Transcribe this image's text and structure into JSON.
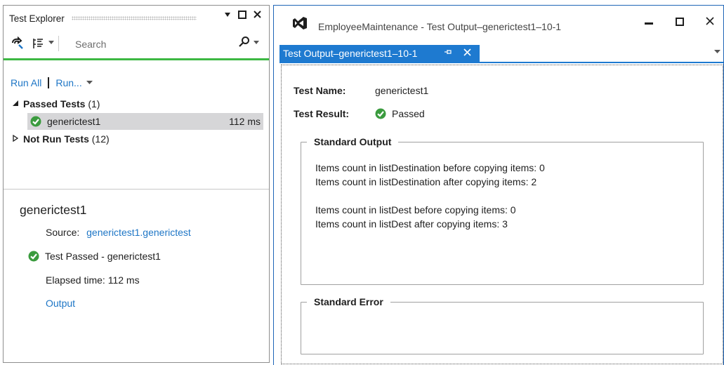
{
  "test_explorer": {
    "title": "Test Explorer",
    "search": {
      "placeholder": "Search",
      "value": ""
    },
    "run_all": "Run All",
    "run_menu": "Run...",
    "groups": {
      "passed": {
        "label": "Passed Tests",
        "count": "(1)"
      },
      "not_run": {
        "label": "Not Run Tests",
        "count": "(12)"
      }
    },
    "tests": [
      {
        "name": "generictest1",
        "duration": "112 ms",
        "status": "passed"
      }
    ],
    "detail": {
      "title": "generictest1",
      "source_label": "Source:",
      "source_link": "generictest1.generictest",
      "result_text": "Test Passed - generictest1",
      "elapsed": "Elapsed time: 112 ms",
      "output_link": "Output"
    }
  },
  "window": {
    "title": "EmployeeMaintenance - Test Output–generictest1–10-1",
    "tab_label": "Test Output–generictest1–10-1",
    "test_name_label": "Test Name:",
    "test_name_value": "generictest1",
    "test_result_label": "Test Result:",
    "test_result_value": "Passed",
    "standard_output_label": "Standard Output",
    "standard_output_lines": [
      "Items count in listDestination before copying items: 0",
      "Items count in listDestination after copying items: 2",
      "",
      "Items count in listDest before copying items: 0",
      "Items count in listDest after copying items: 3"
    ],
    "standard_error_label": "Standard Error"
  },
  "colors": {
    "accent": "#1e7ad0",
    "link": "#1e76c6",
    "pass": "#3a9b3e",
    "search_bar": "#3cb843",
    "selection": "#d6d6d8"
  }
}
